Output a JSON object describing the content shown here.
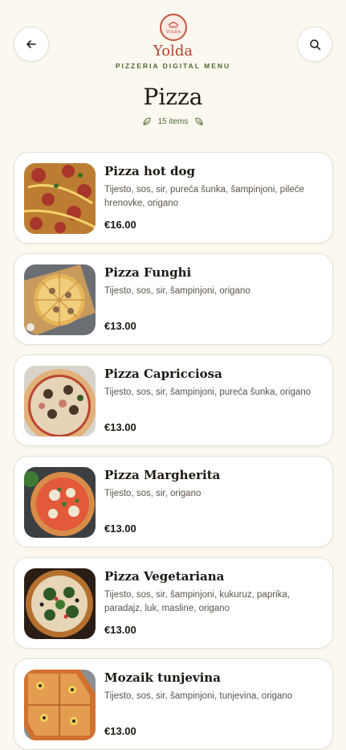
{
  "header": {
    "brand": "Yolda",
    "logo_text": "YOLDA",
    "tagline": "PIZZERIA DIGITAL MENU",
    "back_icon": "arrow-left-icon",
    "search_icon": "search-icon"
  },
  "category": {
    "title": "Pizza",
    "count": "15 items"
  },
  "colors": {
    "background": "#fbf8f0",
    "brand": "#b0432e",
    "accent_green": "#4f6a2e"
  },
  "items": [
    {
      "name": "Pizza hot dog",
      "description": "Tijesto, sos, sir, pureća šunka, šampinjoni, pileće hrenovke, origano",
      "price": "€16.00"
    },
    {
      "name": "Pizza Funghi",
      "description": "Tijesto, sos, sir, šampinjoni, origano",
      "price": "€13.00"
    },
    {
      "name": "Pizza Capricciosa",
      "description": "Tijesto, sos, sir, šampinjoni, pureća šunka, origano",
      "price": "€13.00"
    },
    {
      "name": "Pizza Margherita",
      "description": "Tijesto, sos, sir, origano",
      "price": "€13.00"
    },
    {
      "name": "Pizza Vegetariana",
      "description": "Tijesto, sos, sir, šampinjoni, kukuruz, paprika, paradajz, luk, masline, origano",
      "price": "€13.00"
    },
    {
      "name": "Mozaik tunjevina",
      "description": "Tijesto, sos, sir, šampinjoni, tunjevina, origano",
      "price": "€13.00"
    }
  ]
}
